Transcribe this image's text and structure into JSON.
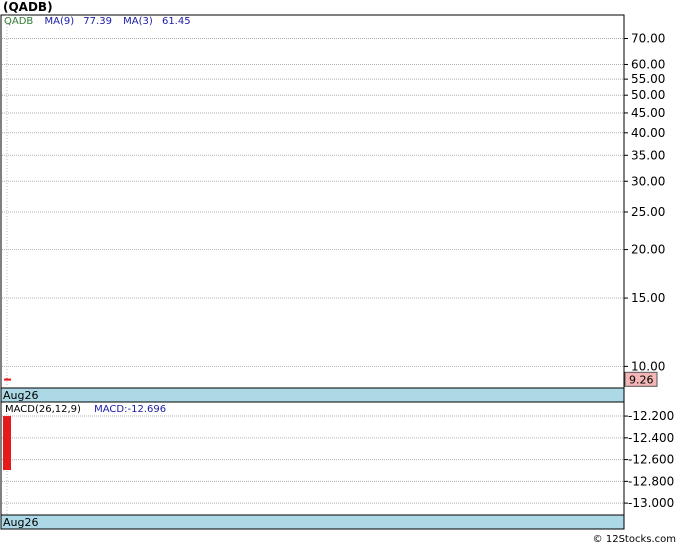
{
  "header": {
    "ticker_title": "(QADB)"
  },
  "price_legend": {
    "symbol": "QADB",
    "ma9_label": "MA(9)",
    "ma9_value": "77.39",
    "ma3_label": "MA(3)",
    "ma3_value": "61.45"
  },
  "macd_legend": {
    "label": "MACD(26,12,9)",
    "value_text": "MACD:-12.696"
  },
  "footer": {
    "watermark": "© 12Stocks.com"
  },
  "colors": {
    "symbol": "#2e7d32",
    "ma": "#1a1aa6",
    "date_bar": "#add8e6",
    "candle_down": "#e41a1c",
    "price_flag_fill": "#f4b6b6",
    "grid": "#b0b0b0"
  },
  "chart_data": [
    {
      "type": "line",
      "panel": "price",
      "scale": "log",
      "x_label": "Aug26",
      "ylim": [
        8.9,
        80
      ],
      "yticks": [
        10,
        15,
        20,
        25,
        30,
        35,
        40,
        45,
        50,
        55,
        60,
        70
      ],
      "ytick_labels": [
        "10.00",
        "15.00",
        "20.00",
        "25.00",
        "30.00",
        "35.00",
        "40.00",
        "45.00",
        "50.00",
        "55.00",
        "60.00",
        "70.00"
      ],
      "last_price": 9.26,
      "last_price_label": "9.26",
      "candles": [
        {
          "date": "Aug26",
          "open": 9.3,
          "close": 9.26,
          "high": 9.35,
          "low": 9.2
        }
      ],
      "grid": true
    },
    {
      "type": "bar",
      "panel": "macd",
      "x_label": "Aug26",
      "ylim": [
        -13.1,
        -12.08
      ],
      "yticks": [
        -12.2,
        -12.4,
        -12.6,
        -12.8,
        -13.0
      ],
      "ytick_labels": [
        "-12.200",
        "-12.400",
        "-12.600",
        "-12.800",
        "-13.000"
      ],
      "bar": {
        "date": "Aug26",
        "top": -12.2,
        "bottom": -12.696
      },
      "grid": true
    }
  ]
}
